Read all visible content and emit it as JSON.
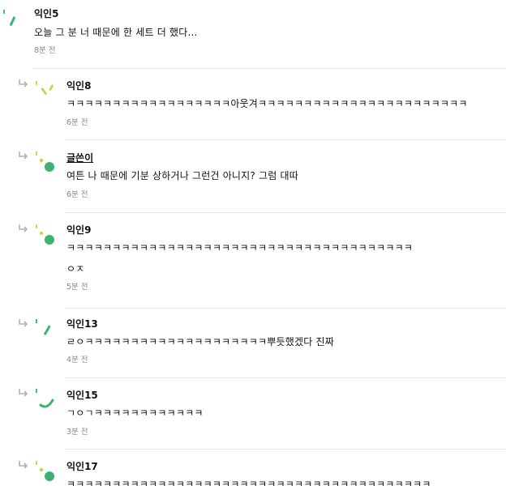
{
  "comments": [
    {
      "name": "익인5",
      "lines": [
        "오늘 그 분 너 때문에 한 세트 더 했다..."
      ],
      "time": "8분 전",
      "avatar": "green-dash-icon"
    },
    {
      "name": "익인8",
      "lines": [
        "ㅋㅋㅋㅋㅋㅋㅋㅋㅋㅋㅋㅋㅋㅋㅋㅋㅋㅋ아웃겨ㅋㅋㅋㅋㅋㅋㅋㅋㅋㅋㅋㅋㅋㅋㅋㅋㅋㅋㅋㅋㅋㅋㅋ"
      ],
      "time": "6분 전",
      "avatar": "yellow-green-dashes-icon"
    },
    {
      "name": "글쓴이",
      "lines": [
        "여튼 나 때문에 기분 상하거나 그런건 아니지? 그럼 대따"
      ],
      "time": "6분 전",
      "avatar": "green-dots-icon",
      "is_author": true
    },
    {
      "name": "익인9",
      "lines": [
        "ㅋㅋㅋㅋㅋㅋㅋㅋㅋㅋㅋㅋㅋㅋㅋㅋㅋㅋㅋㅋㅋㅋㅋㅋㅋㅋㅋㅋㅋㅋㅋㅋㅋㅋㅋㅋㅋㅋ",
        "ㅇㅈ"
      ],
      "time": "5분 전",
      "avatar": "green-dots-icon"
    },
    {
      "name": "익인13",
      "lines": [
        "ㄹㅇㅋㅋㅋㅋㅋㅋㅋㅋㅋㅋㅋㅋㅋㅋㅋㅋㅋㅋㅋㅋ뿌듯했겠다 진짜"
      ],
      "time": "4분 전",
      "avatar": "green-dash-icon"
    },
    {
      "name": "익인15",
      "lines": [
        "ㄱㅇㄱㅋㅋㅋㅋㅋㅋㅋㅋㅋㅋㅋㅋ"
      ],
      "time": "3분 전",
      "avatar": "green-arc-icon"
    },
    {
      "name": "익인17",
      "lines": [
        "ㅋㅋㅋㅋㅋㅋㅋㅋㅋㅋㅋㅋㅋㅋㅋㅋㅋㅋㅋㅋㅋㅋㅋㅋㅋㅋㅋㅋㅋㅋㅋㅋㅋㅋㅋㅋㅋㅋㅋㅋ"
      ],
      "time": "",
      "avatar": "green-dots-icon"
    }
  ],
  "colors": {
    "green": "#3cb371",
    "yellow_green": "#c9d34a",
    "reply_arrow": "#b0b0b0",
    "divider": "#e6e6e6"
  }
}
